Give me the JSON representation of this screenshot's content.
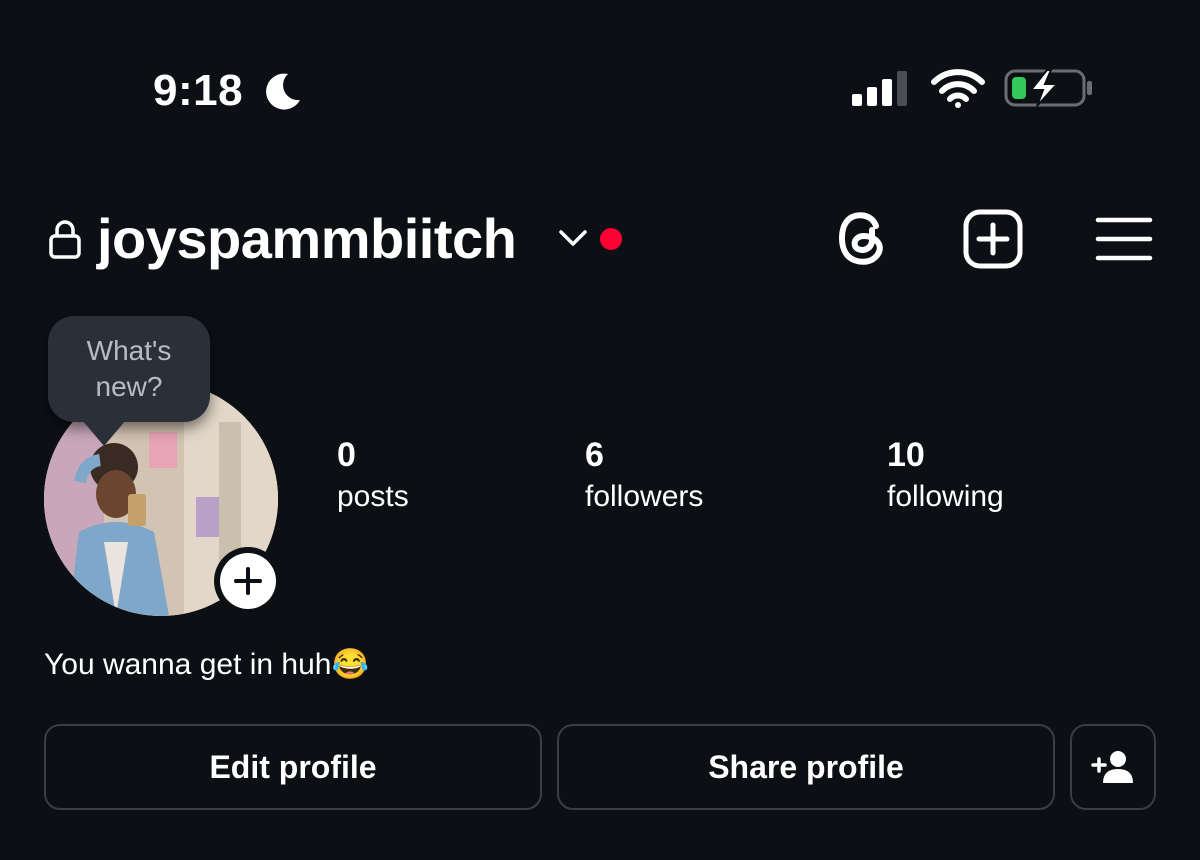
{
  "status_bar": {
    "time": "9:18",
    "focus_icon": "moon-icon",
    "signal_icon": "cellular-signal-icon",
    "wifi_icon": "wifi-icon",
    "battery_icon": "battery-charging-icon",
    "battery_level": 0.2
  },
  "header": {
    "username": "joyspammbiitch",
    "lock_icon": "lock-icon",
    "notification_dot_color": "#ff0033",
    "actions": [
      "threads-icon",
      "create-post-icon",
      "menu-icon"
    ]
  },
  "profile": {
    "note_bubble": "What's new?",
    "avatar_icon": "profile-photo",
    "bio": "You wanna get in huh😂",
    "stats": {
      "posts": {
        "value": "0",
        "label": "posts"
      },
      "followers": {
        "value": "6",
        "label": "followers"
      },
      "following": {
        "value": "10",
        "label": "following"
      }
    }
  },
  "buttons": {
    "edit": "Edit profile",
    "share": "Share profile",
    "add_user_icon": "add-person-icon"
  },
  "colors": {
    "background": "#0c0f14",
    "text": "#ffffff",
    "button_border": "#3a3d44",
    "battery_green": "#34c759"
  }
}
